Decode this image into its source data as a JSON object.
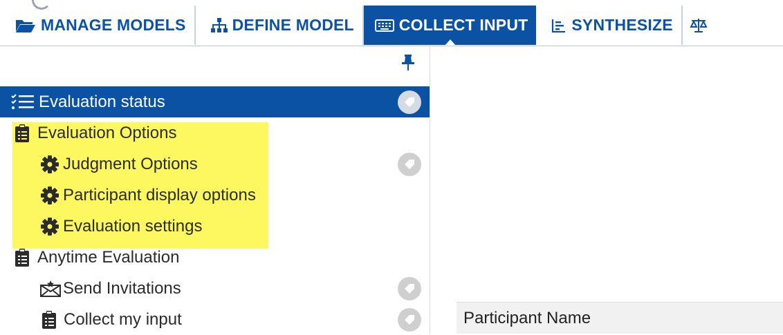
{
  "nav": {
    "tabs": [
      {
        "label": "MANAGE MODELS",
        "icon": "folder-open-icon",
        "active": false
      },
      {
        "label": "DEFINE MODEL",
        "icon": "sitemap-icon",
        "active": false
      },
      {
        "label": "COLLECT INPUT",
        "icon": "keyboard-icon",
        "active": true
      },
      {
        "label": "SYNTHESIZE",
        "icon": "bar-chart-icon",
        "active": false
      }
    ],
    "accent_color": "#0b52a4"
  },
  "sidebar": {
    "pin_icon": "pin-icon",
    "items": [
      {
        "label": "Evaluation status",
        "icon": "checklist-icon",
        "active": true,
        "has_badge": true
      },
      {
        "label": "Evaluation Options",
        "icon": "clipboard-icon",
        "active": false,
        "has_badge": false
      },
      {
        "label": "Judgment Options",
        "icon": "gear-icon",
        "active": false,
        "has_badge": true
      },
      {
        "label": "Participant display options",
        "icon": "gear-icon",
        "active": false,
        "has_badge": false
      },
      {
        "label": "Evaluation settings",
        "icon": "gear-icon",
        "active": false,
        "has_badge": false
      },
      {
        "label": "Anytime Evaluation",
        "icon": "clipboard-icon",
        "active": false,
        "has_badge": false
      },
      {
        "label": "Send Invitations",
        "icon": "envelope-icon",
        "active": false,
        "has_badge": true
      },
      {
        "label": "Collect my input",
        "icon": "clipboard-icon",
        "active": false,
        "has_badge": true
      }
    ],
    "highlight_color": "#fdf85f"
  },
  "main": {
    "table": {
      "columns": [
        "Participant Name"
      ]
    }
  }
}
